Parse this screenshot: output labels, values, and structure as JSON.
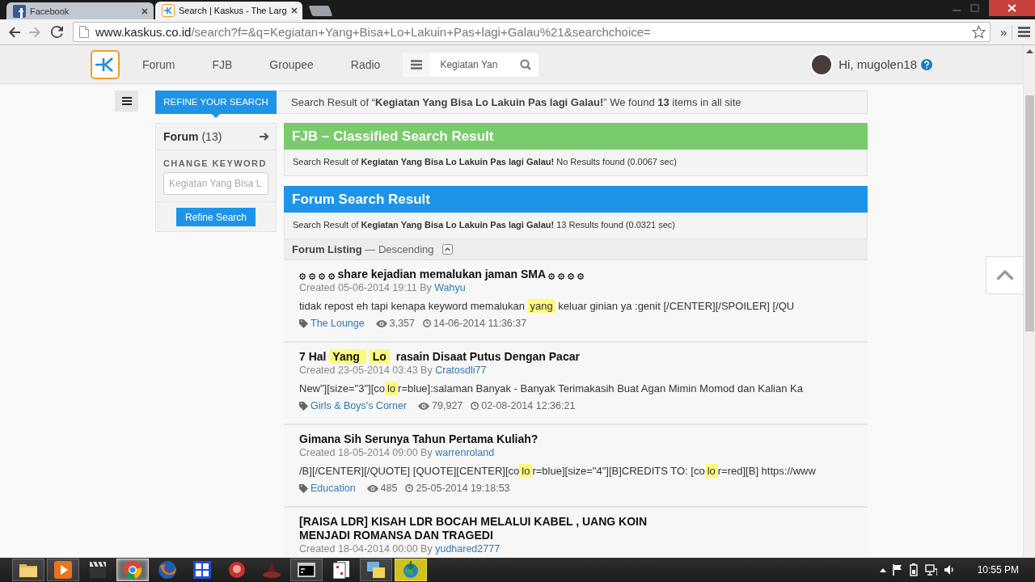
{
  "browser": {
    "tabs": [
      {
        "title": "Facebook",
        "selected": false
      },
      {
        "title": "Search | Kaskus - The Larg",
        "selected": true
      }
    ],
    "address": {
      "host": "www.kaskus.co.id",
      "path": "/search?f=&q=Kegiatan+Yang+Bisa+Lo+Lakuin+Pas+lagi+Galau%21&searchchoice="
    },
    "overflow_button": "»"
  },
  "site_header": {
    "nav": [
      "Forum",
      "FJB",
      "Groupee",
      "Radio"
    ],
    "search": {
      "value": "Kegiatan Yan"
    },
    "greeting": "Hi, mugolen18"
  },
  "refine": {
    "tab_label": "REFINE YOUR SEARCH",
    "category": "**Forum** (13)",
    "keyword_label": "CHANGE KEYWORD",
    "keyword_field": {
      "placeholder": "Kegiatan Yang Bisa L"
    },
    "button": "Refine Search"
  },
  "summary": "Search Result of “**Kegiatan Yang Bisa Lo Lakuin Pas lagi Galau!**” We found **13** items in all site",
  "sections": [
    {
      "title": "FJB – Classified Search Result",
      "color": "#78cc6b",
      "summary": "Search Result of **Kegiatan Yang Bisa Lo Lakuin Pas lagi Galau!** No Results found (0.0067 sec)"
    },
    {
      "title": "Forum Search Result",
      "color": "#1e94e8",
      "summary": "Search Result of **Kegiatan Yang Bisa Lo Lakuin Pas lagi Galau!** 13 Results found (0.0321 sec)"
    }
  ],
  "listing": {
    "label": "**Forum Listing** — Descending"
  },
  "results": [
    {
      "title": [
        {
          "text": "۞ ۞ ۞ ۞ share kejadian memalukan jaman SMA ۞ ۞ ۞ ۞",
          "highlight": false
        }
      ],
      "created": "Created 05-06-2014 19:11 By",
      "author": "Wahyu",
      "snippet": [
        {
          "text": "tidak repost eh tapi kenapa keyword memalukan ",
          "highlight": false
        },
        {
          "text": "yang",
          "highlight": true
        },
        {
          "text": " keluar ginian ya :genit [/CENTER][/SPOILER] [/QU",
          "highlight": false
        }
      ],
      "category": "The Lounge",
      "views": "3,357",
      "last_post": "14-06-2014 11:36:37"
    },
    {
      "title": [
        {
          "text": "7 Hal ",
          "highlight": false
        },
        {
          "text": "Yang ",
          "highlight": true
        },
        {
          "text": "Lo",
          "highlight": true
        },
        {
          "text": " rasain Disaat Putus Dengan Pacar",
          "highlight": false
        }
      ],
      "created": "Created 23-05-2014 03:43 By",
      "author": "Cratosdli77",
      "snippet": [
        {
          "text": "New\"][size=\"3\"][co",
          "highlight": false
        },
        {
          "text": "lo",
          "highlight": true
        },
        {
          "text": "r=blue]:salaman Banyak - Banyak Terimakasih Buat Agan Mimin Momod dan Kalian Ka",
          "highlight": false
        }
      ],
      "category": "Girls & Boys's Corner",
      "views": "79,927",
      "last_post": "02-08-2014 12:36:21"
    },
    {
      "title": [
        {
          "text": "Gimana Sih Serunya Tahun Pertama Kuliah?",
          "highlight": false
        }
      ],
      "created": "Created 18-05-2014 09:00 By",
      "author": "warrenroland",
      "snippet": [
        {
          "text": "/B][/CENTER][/QUOTE] [QUOTE][CENTER][co",
          "highlight": false
        },
        {
          "text": "lo",
          "highlight": true
        },
        {
          "text": "r=blue][size=\"4\"][B]CREDITS TO: [co",
          "highlight": false
        },
        {
          "text": "lo",
          "highlight": true
        },
        {
          "text": "r=red][B] https://www",
          "highlight": false
        }
      ],
      "category": "Education",
      "views": "485",
      "last_post": "25-05-2014 19:18:53"
    },
    {
      "title": [
        {
          "text": "[RAISA LDR] KISAH LDR BOCAH MELALUI KABEL , UANG KOIN MENJADI ROMANSA DAN TRAGEDI",
          "highlight": false
        }
      ],
      "created": "Created 18-04-2014 00:00 By",
      "author": "yudhared2777"
    }
  ],
  "taskbar": {
    "apps": [
      {
        "running": true,
        "selected": false,
        "flashing": false
      },
      {
        "running": true,
        "selected": false,
        "flashing": false
      },
      {
        "running": false,
        "selected": false,
        "flashing": false
      },
      {
        "running": true,
        "selected": true,
        "flashing": false
      },
      {
        "running": false,
        "selected": false,
        "flashing": false
      },
      {
        "running": false,
        "selected": false,
        "flashing": false
      },
      {
        "running": false,
        "selected": false,
        "flashing": false
      },
      {
        "running": false,
        "selected": false,
        "flashing": false
      },
      {
        "running": true,
        "selected": false,
        "flashing": false
      },
      {
        "running": false,
        "selected": false,
        "flashing": false
      },
      {
        "running": true,
        "selected": false,
        "flashing": false
      },
      {
        "running": true,
        "selected": false,
        "flashing": true
      }
    ],
    "clock": "10:55 PM"
  }
}
